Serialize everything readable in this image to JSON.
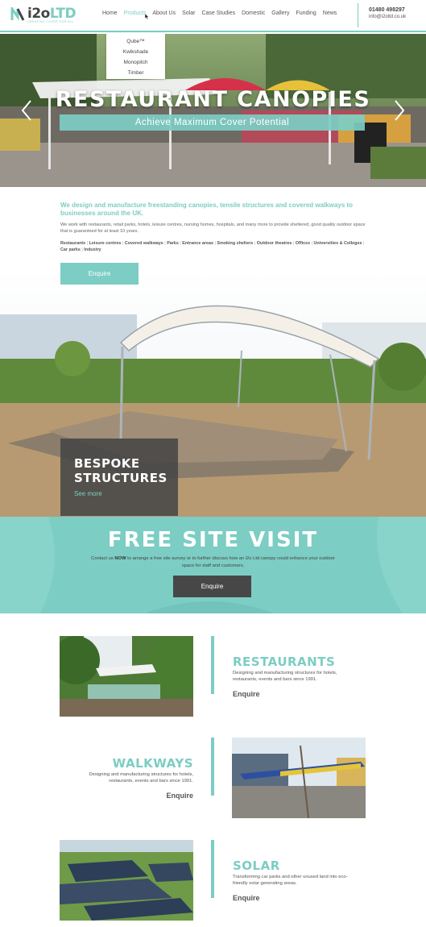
{
  "header": {
    "logo_main": "i2o",
    "logo_accent": "LTD",
    "logo_tagline": "CREATING COVER FOR ALL",
    "nav": [
      "Home",
      "Products",
      "About Us",
      "Solar",
      "Case Studies",
      "Domestic",
      "Gallery",
      "Funding",
      "News"
    ],
    "phone": "01480 498297",
    "email": "info@i2oltd.co.uk"
  },
  "dropdown": [
    "Qube™",
    "Kwikshade",
    "Monopitch",
    "Timber"
  ],
  "hero": {
    "title": "RESTAURANT CANOPIES",
    "subtitle": "Achieve Maximum Cover Potential"
  },
  "intro": {
    "headline": "We design and manufacture freestanding canopies, tensile structures and covered walkways to businesses around the UK.",
    "body": "We work with restaurants, retail parks, hotels, leisure centres, nursing homes, hospitals, and many more to provide sheltered, good quality outdoor space that is guaranteed for at least 10 years.",
    "sectors": [
      "Restaurants",
      "Leisure centres",
      "Covered walkways",
      "Parks",
      "Entrance areas",
      "Smoking shelters",
      "Outdoor theatres",
      "Offices",
      "Universities & Colleges",
      "Car parks",
      "Industry"
    ],
    "button": "Enquire"
  },
  "bespoke": {
    "title_line1": "BESPOKE",
    "title_line2": "STRUCTURES",
    "link": "See more"
  },
  "visit": {
    "title": "FREE SITE VISIT",
    "text_pre": "Contact us ",
    "text_bold": "NOW",
    "text_post": " to arrange a free site survey or to further discuss how an i2o Ltd canopy could enhance your outdoor space for staff and customers.",
    "button": "Enquire"
  },
  "rows": [
    {
      "title": "RESTAURANTS",
      "desc": "Designing and manufacturing structures for hotels, restaurants, events and bars since 1991.",
      "link": "Enquire"
    },
    {
      "title": "WALKWAYS",
      "desc": "Designing and manufacturing structures for hotels, restaurants, events and bars since 1991.",
      "link": "Enquire"
    },
    {
      "title": "SOLAR",
      "desc": "Transforming car parks and other unused land into eco-friendly solar generating areas.",
      "link": "Enquire"
    }
  ],
  "colors": {
    "accent": "#7ccdc3",
    "dark": "#474747"
  }
}
